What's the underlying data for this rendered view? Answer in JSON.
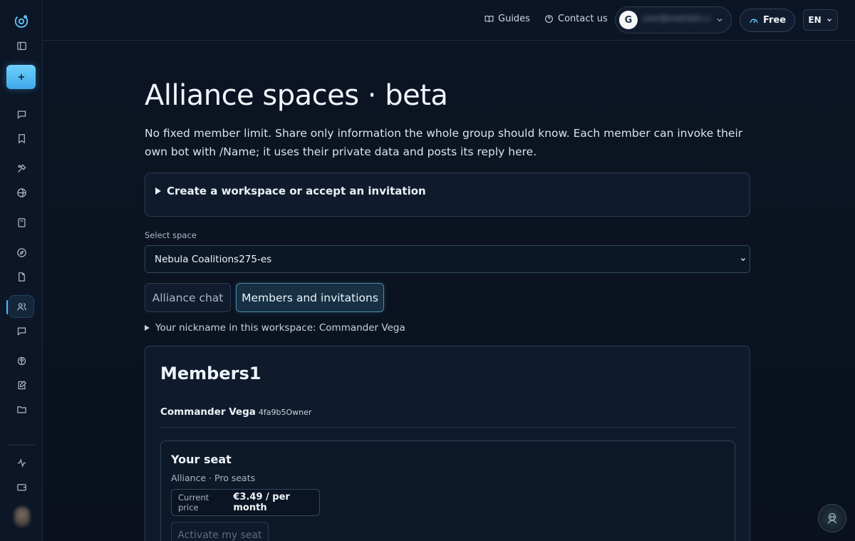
{
  "topbar": {
    "guides_label": "Guides",
    "contact_label": "Contact us",
    "account_initial": "G",
    "account_email": "user@example.com",
    "plan_label": "Free",
    "language": "EN"
  },
  "page": {
    "title": "Alliance spaces · beta",
    "description": "No fixed member limit. Share only information the whole group should know. Each member can invoke their own bot with /Name; it uses their private data and posts its reply here.",
    "create_summary": "Create a workspace or accept an invitation",
    "select_label": "Select space",
    "selected_space": "Nebula Coalitions275-es",
    "tabs": {
      "chat": "Alliance chat",
      "members": "Members and invitations"
    },
    "nickname_summary": "Your nickname in this workspace: Commander Vega"
  },
  "members": {
    "title": "Members1",
    "rows": [
      {
        "name": "Commander Vega",
        "meta": "4fa9b5Owner"
      }
    ]
  },
  "seat": {
    "title": "Your seat",
    "subtitle": "Alliance · Pro seats",
    "price_label": "Current price",
    "price_value": "€3.49 / per month",
    "activate_label": "Activate my seat"
  },
  "colors": {
    "accent": "#5fc7ff",
    "background": "#0b1220",
    "active_tab": "#173044"
  },
  "icons": {
    "sidebar": [
      "logo-icon",
      "panel-toggle-icon",
      "plus-icon",
      "chat-icon",
      "bookmark-icon",
      "tools-icon",
      "globe-icon",
      "calculator-icon",
      "compass-icon",
      "document-icon",
      "users-icon",
      "message-icon",
      "brain-icon",
      "edit-icon",
      "folder-icon",
      "activity-icon",
      "wallet-icon"
    ]
  }
}
